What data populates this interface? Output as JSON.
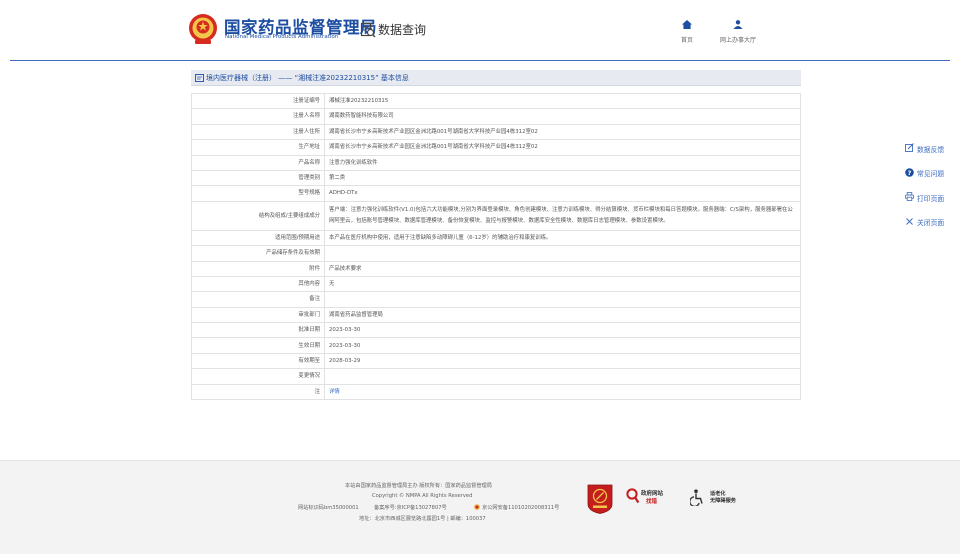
{
  "header": {
    "brand_cn": "国家药品监督管理局",
    "brand_en": "National Medical Products Administration",
    "query_label": "数据查询",
    "nav": [
      {
        "label": "首页",
        "icon": "home-icon"
      },
      {
        "label": "网上办事大厅",
        "icon": "user-icon"
      }
    ]
  },
  "breadcrumb": {
    "text": "境内医疗器械（注册） —— “湘械注准20232210315” 基本信息"
  },
  "record": {
    "rows": [
      {
        "key": "注册证编号",
        "value": "湘械注准20232210315"
      },
      {
        "key": "注册人名称",
        "value": "湖南数药智能科技有限公司"
      },
      {
        "key": "注册人住所",
        "value": "湖南省长沙市宁乡高新技术产业园区金洲北路001号湖南省大学科技产业园4栋312室02"
      },
      {
        "key": "生产地址",
        "value": "湖南省长沙市宁乡高新技术产业园区金洲北路001号湖南省大学科技产业园4栋312室02"
      },
      {
        "key": "产品名称",
        "value": "注意力强化训练软件"
      },
      {
        "key": "管理类别",
        "value": "第二类"
      },
      {
        "key": "型号规格",
        "value": "ADHD-DTx"
      },
      {
        "key": "结构及组成/主要组成成分",
        "value": "客户端：注意力强化训练软件(V1.0)包括六大功能模块,分别为界面登录模块、角色创建模块、注意力训练模块、得分结算模块、货币栏模块和每日答题模块。服务器端：C/S架构，服务器部署在公网阿里云，包括账号管理模块、数据库管理模块、备份恢复模块、监控与报警模块、数据库安全性模块、数据库日志管理模块、参数设置模块。",
        "multi": true
      },
      {
        "key": "适用范围/预期用途",
        "value": "本产品在医疗机构中使用，适用于注意缺陷多动障碍儿童（6-12岁）的辅助治疗和康复训练。"
      },
      {
        "key": "产品储存条件及有效期",
        "value": ""
      },
      {
        "key": "附件",
        "value": "产品技术要求"
      },
      {
        "key": "其他内容",
        "value": "无"
      },
      {
        "key": "备注",
        "value": ""
      },
      {
        "key": "审批部门",
        "value": "湖南省药品监督管理局"
      },
      {
        "key": "批准日期",
        "value": "2023-03-30"
      },
      {
        "key": "生效日期",
        "value": "2023-03-30"
      },
      {
        "key": "有效期至",
        "value": "2028-03-29"
      },
      {
        "key": "变更情况",
        "value": ""
      },
      {
        "key": "注",
        "value": "详情",
        "link": true
      }
    ]
  },
  "tools": [
    {
      "label": "数据反馈",
      "icon": "edit-icon"
    },
    {
      "label": "常见问题",
      "icon": "question-icon"
    },
    {
      "label": "打印页面",
      "icon": "print-icon"
    },
    {
      "label": "关闭页面",
      "icon": "close-icon"
    }
  ],
  "footer": {
    "line1": "本站由国家药品监督管理局主办 版权所有：国家药品监督管理局",
    "line2": "Copyright © NMPA All Rights Reserved",
    "line3_a": "网站标识码bm35000001",
    "line3_b": "备案序号:京ICP备13027807号",
    "line3_c": "京公网安备11010202008311号",
    "line4": "地址：北京市西城区展览路北露园1号 | 邮编：100037",
    "gov_badge_1": "政府网站",
    "gov_badge_2": "找错",
    "acc_badge_1": "适老化",
    "acc_badge_2": "无障碍服务"
  },
  "colors": {
    "brand_blue": "#1d4ea2",
    "link_blue": "#3d6cc0",
    "party_red": "#c41d1d"
  }
}
